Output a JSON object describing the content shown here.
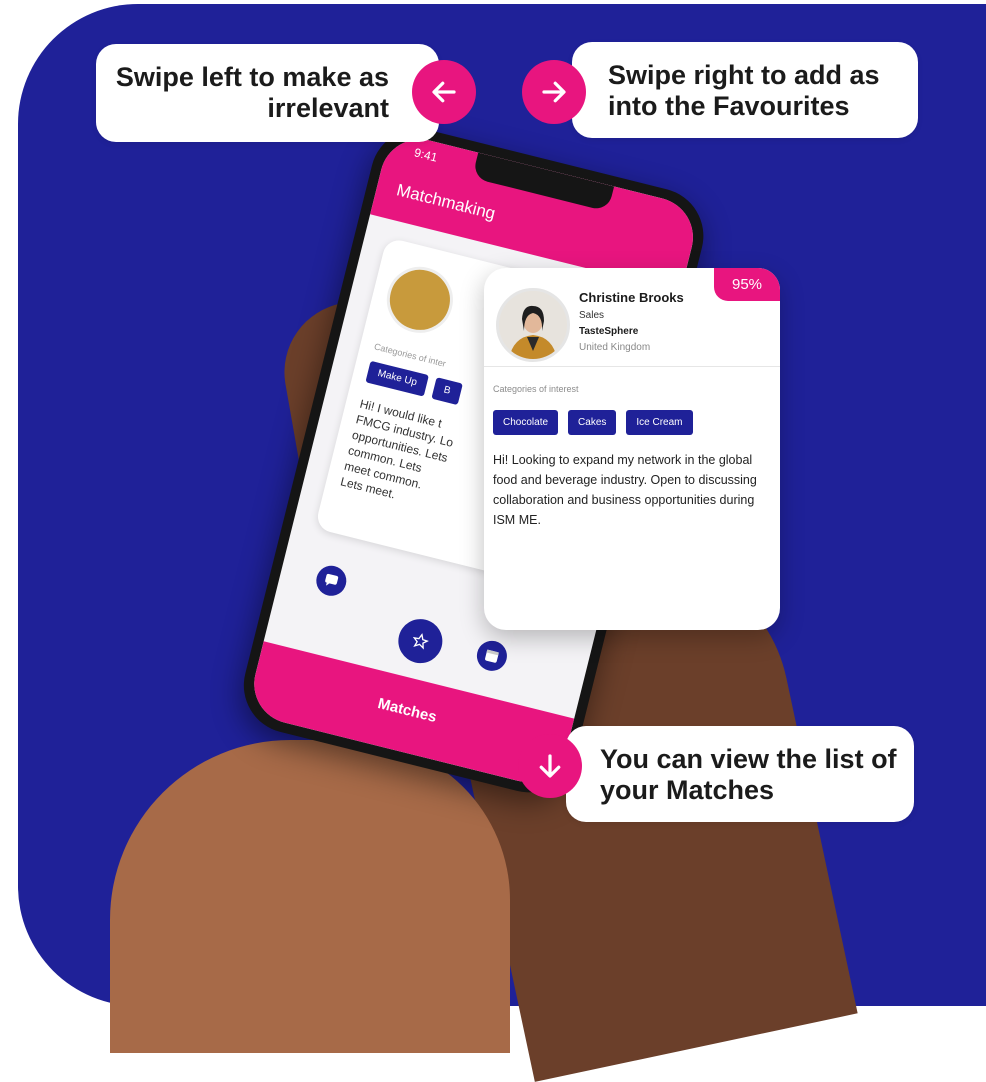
{
  "callouts": {
    "left_text": "Swipe left to make as irrelevant",
    "right_text": "Swipe right to add as into the Favourites",
    "bottom_text": "You can view the list of your Matches"
  },
  "icons": {
    "left": "arrow-left-icon",
    "right": "arrow-right-icon",
    "down": "arrow-down-icon",
    "chat": "chat-icon",
    "star": "star-icon",
    "calendar": "calendar-icon"
  },
  "colors": {
    "accent": "#e8157f",
    "brand": "#1f2198"
  },
  "phone": {
    "time": "9:41",
    "title": "Matchmaking",
    "footer_label": "Matches",
    "back_card": {
      "categories_label": "Categories of inter",
      "tags": [
        "Make Up",
        "B"
      ],
      "text": "Hi! I would like t FMCG industry. Lo opportunities. Lets common. Lets meet common. Lets meet."
    }
  },
  "profile": {
    "match": "95%",
    "name": "Christine Brooks",
    "role": "Sales",
    "company": "TasteSphere",
    "country": "United Kingdom",
    "categories_label": "Categories of interest",
    "tags": [
      "Chocolate",
      "Cakes",
      "Ice Cream"
    ],
    "bio": "Hi! Looking to expand my network in the global food and beverage industry. Open to discussing collaboration and business opportunities during ISM ME."
  }
}
